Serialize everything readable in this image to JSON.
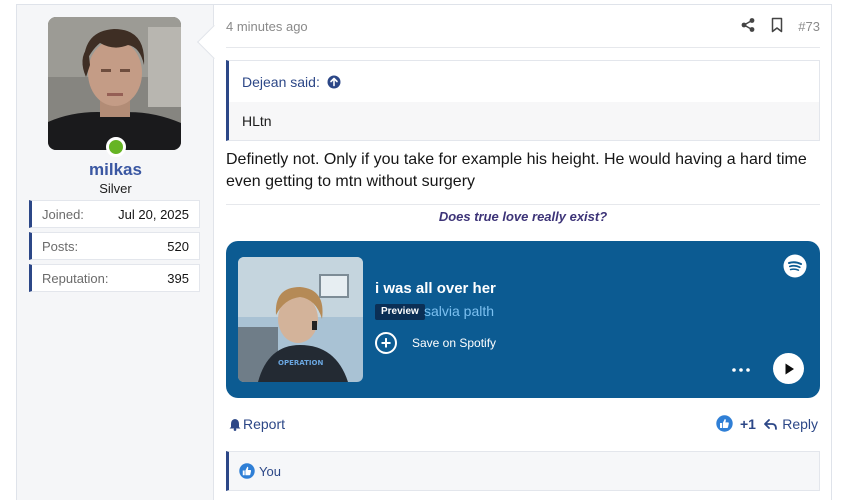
{
  "user": {
    "name": "milkas",
    "title": "Silver",
    "stats": [
      {
        "label": "Joined:",
        "value": "Jul 20, 2025"
      },
      {
        "label": "Posts:",
        "value": "520"
      },
      {
        "label": "Reputation:",
        "value": "395"
      }
    ],
    "status_color": "#66b424"
  },
  "post": {
    "time": "4 minutes ago",
    "number": "#73",
    "quote": {
      "author": "Dejean said:",
      "text": "HLtn"
    },
    "message": "Definetly not. Only if you take for example his height. He would having a hard time even getting to mtn without surgery",
    "signature": "Does true love really exist?"
  },
  "spotify": {
    "track": "i was all over her",
    "badge": "Preview",
    "artist": "salvia palth",
    "save_label": "Save on Spotify",
    "bg_color": "#0c5b92"
  },
  "actions": {
    "report": "Report",
    "reaction_count": "+1",
    "reply": "Reply"
  },
  "reactions": {
    "text": "You"
  },
  "icons": [
    "share-icon",
    "bookmark-icon",
    "arrow-up-circle-icon",
    "spotify-icon",
    "plus-circle-icon",
    "more-icon",
    "play-icon",
    "bell-icon",
    "like-icon",
    "reply-icon"
  ],
  "colors": {
    "accent": "#2c4787",
    "link": "#3a57a2"
  }
}
